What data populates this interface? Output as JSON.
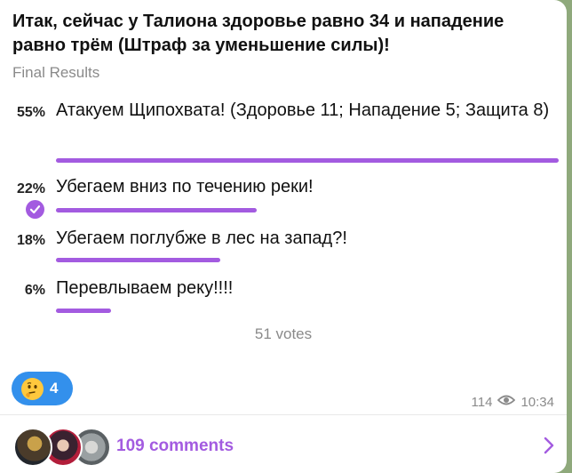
{
  "poll": {
    "question": "Итак, сейчас у Талиона здоровье равно 34 и нападение равно трём (Штраф за уменьшение силы)!",
    "status": "Final Results",
    "options": [
      {
        "percent_label": "55%",
        "text": "Атакуем Щипохвата! (Здоровье 11; Нападение 5; Защита 8)",
        "percent": 55,
        "chosen": false
      },
      {
        "percent_label": "22%",
        "text": "Убегаем вниз по течению реки!",
        "percent": 22,
        "chosen": true
      },
      {
        "percent_label": "18%",
        "text": "Убегаем поглубже в лес на запад?!",
        "percent": 18,
        "chosen": false
      },
      {
        "percent_label": "6%",
        "text": "Перевлываем реку!!!!",
        "percent": 6,
        "chosen": false
      }
    ],
    "votes": "51 votes"
  },
  "reaction": {
    "icon": "thinking-face-icon",
    "count": "4"
  },
  "meta": {
    "views": "114",
    "view_icon": "eye-icon",
    "time": "10:34"
  },
  "comments": {
    "label": "109 comments",
    "chevron_icon": "chevron-right-icon"
  },
  "colors": {
    "accent": "#a35be0",
    "reaction_bg": "#3390ec",
    "muted": "#8a8a8a",
    "background": "#8fa97c"
  }
}
